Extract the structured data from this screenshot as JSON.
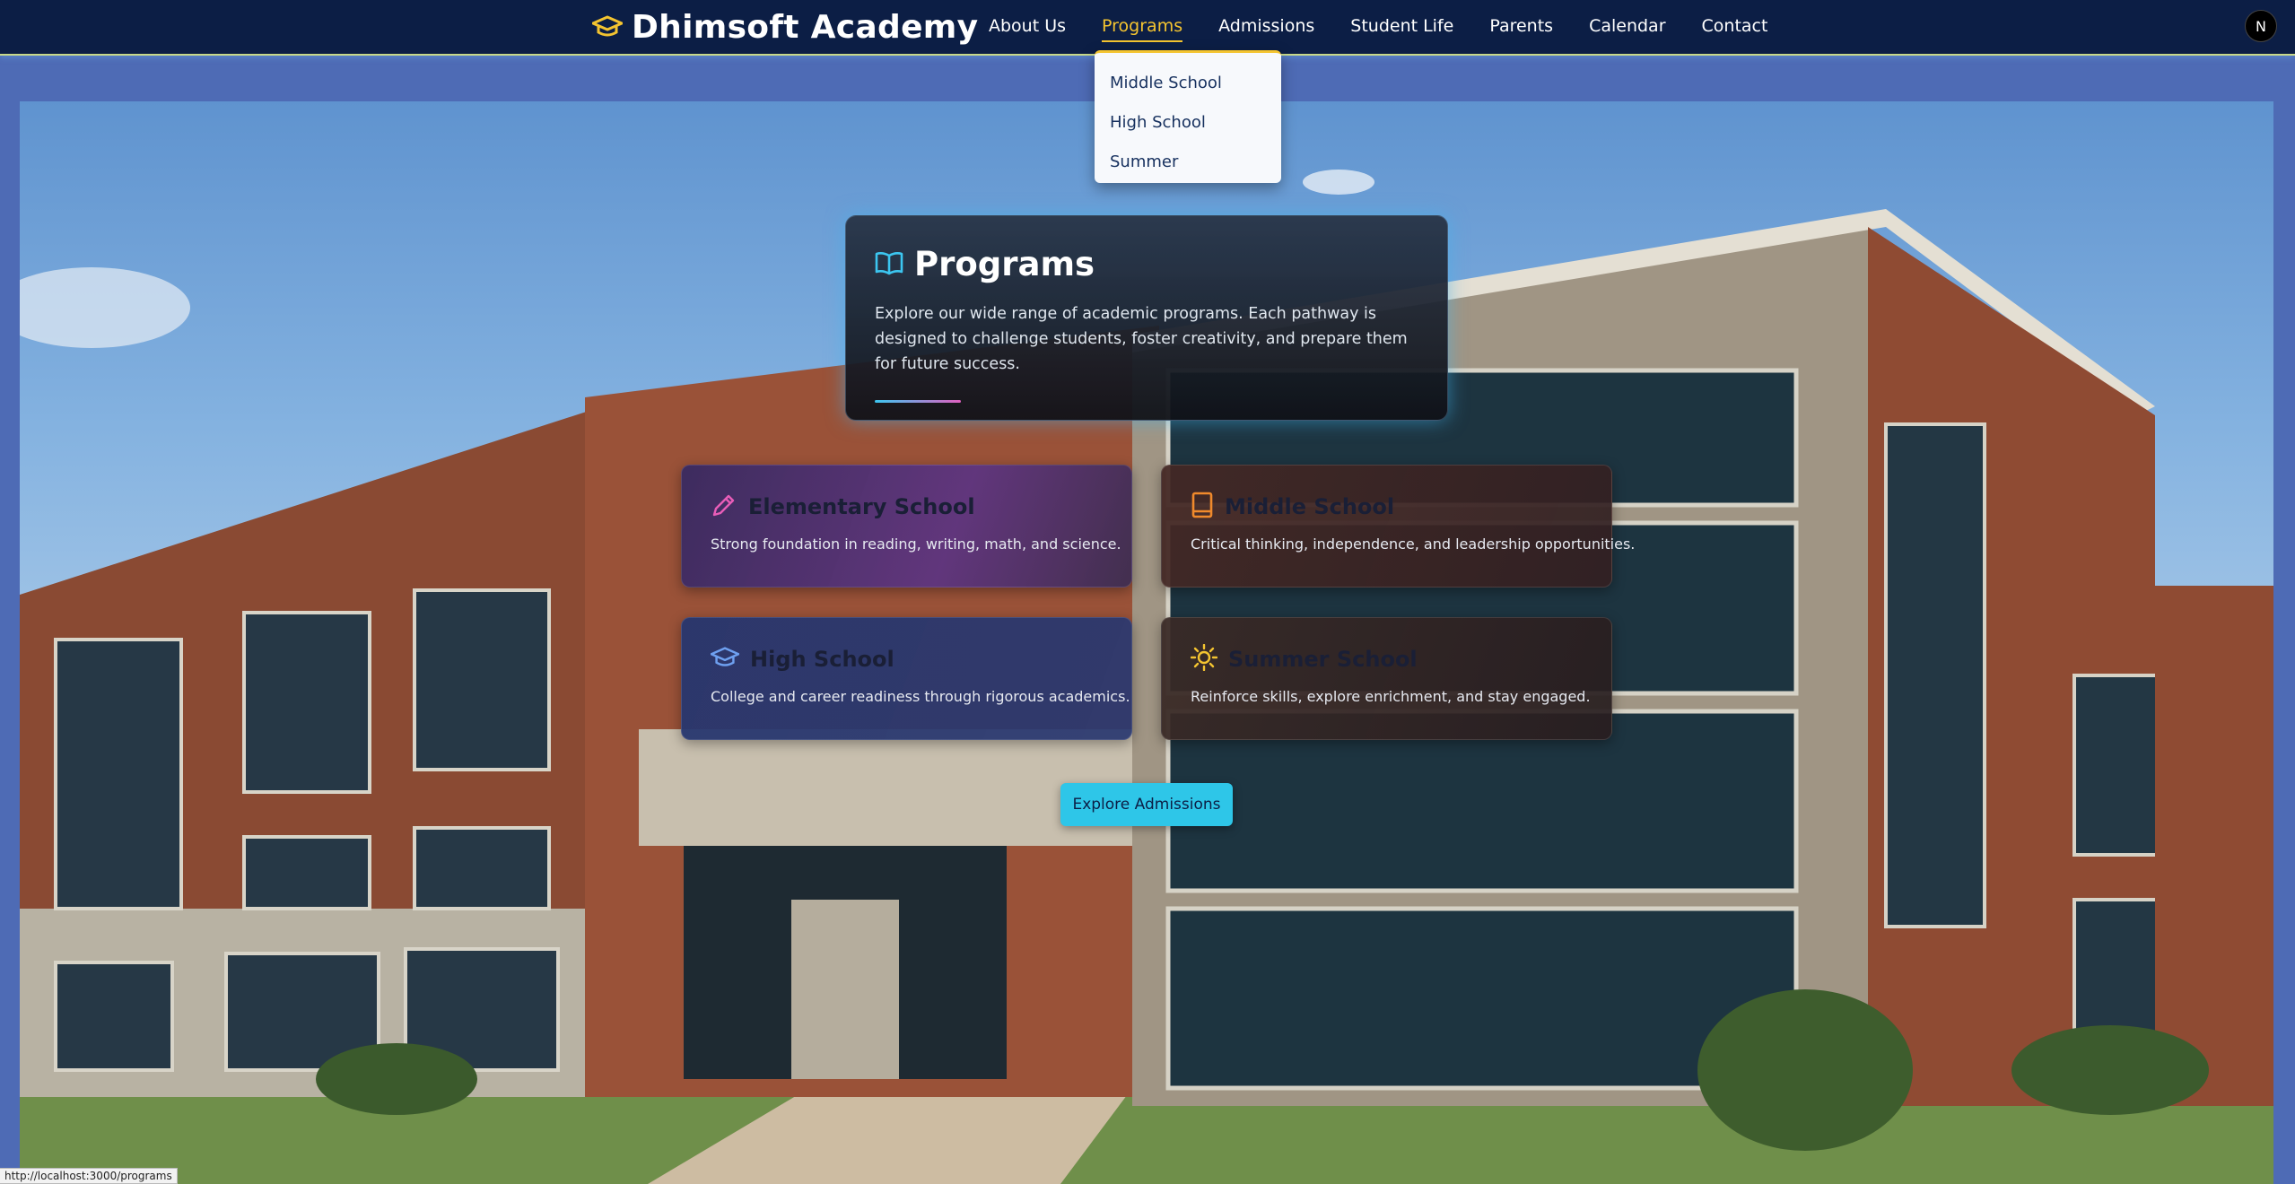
{
  "brand": {
    "title": "Dhimsoft Academy",
    "icon": "graduation-cap-icon",
    "accent": "#f4c430"
  },
  "nav": {
    "items": [
      {
        "label": "About Us"
      },
      {
        "label": "Programs",
        "active": true
      },
      {
        "label": "Admissions"
      },
      {
        "label": "Student Life"
      },
      {
        "label": "Parents"
      },
      {
        "label": "Calendar"
      },
      {
        "label": "Contact"
      }
    ],
    "avatar": "N"
  },
  "dropdown": {
    "items": [
      "Middle School",
      "High School",
      "Summer"
    ]
  },
  "intro": {
    "icon": "open-book-icon",
    "title": "Programs",
    "text": "Explore our wide range of academic programs. Each pathway is designed to challenge students, foster creativity, and prepare them for future success."
  },
  "programs": [
    {
      "icon": "pencil-icon",
      "icon_color": "#e85db8",
      "title": "Elementary School",
      "desc": "Strong foundation in reading, writing, math, and science."
    },
    {
      "icon": "book-icon",
      "icon_color": "#f08a2c",
      "title": "Middle School",
      "desc": "Critical thinking, independence, and leadership opportunities."
    },
    {
      "icon": "graduation-cap-icon",
      "icon_color": "#6ea0f0",
      "title": "High School",
      "desc": "College and career readiness through rigorous academics."
    },
    {
      "icon": "sun-icon",
      "icon_color": "#f4c430",
      "title": "Summer School",
      "desc": "Reinforce skills, explore enrichment, and stay engaged."
    }
  ],
  "cta": {
    "label": "Explore Admissions",
    "color": "#2ec6e8"
  },
  "status": {
    "url": "http://localhost:3000/programs"
  }
}
